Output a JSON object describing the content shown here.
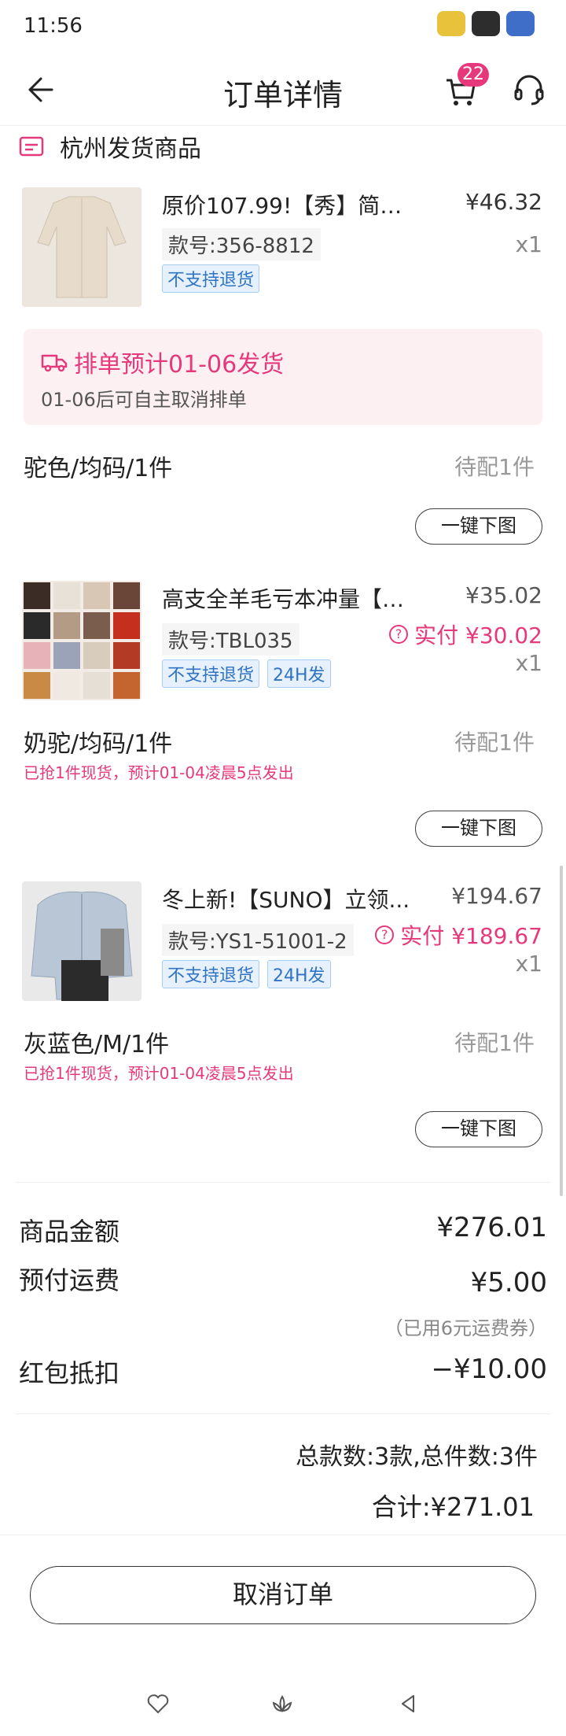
{
  "status_bar": {
    "time": "11:56"
  },
  "nav": {
    "title": "订单详情",
    "cart_badge": "22"
  },
  "section": {
    "title": "杭州发货商品"
  },
  "products": [
    {
      "title": "原价107.99!【秀】简约...",
      "price": "¥46.32",
      "code": "款号:356-8812",
      "qty": "x1",
      "tags": [
        "不支持退货"
      ],
      "notice_title": "排单预计01-06发货",
      "notice_sub": "01-06后可自主取消排单",
      "variant": "驼色/均码/1件",
      "pending": "待配1件",
      "download": "一键下图"
    },
    {
      "title": "高支全羊毛亏本冲量【M...",
      "price": "¥35.02",
      "code": "款号:TBL035",
      "paid_label": "实付 ¥30.02",
      "qty": "x1",
      "tags": [
        "不支持退货",
        "24H发"
      ],
      "variant": "奶驼/均码/1件",
      "pending": "待配1件",
      "stock_note": "已抢1件现货，预计01-04凌晨5点发出",
      "download": "一键下图"
    },
    {
      "title": "冬上新!【SUNO】立领...",
      "price": "¥194.67",
      "code": "款号:YS1-51001-2",
      "paid_label": "实付 ¥189.67",
      "qty": "x1",
      "tags": [
        "不支持退货",
        "24H发"
      ],
      "variant": "灰蓝色/M/1件",
      "pending": "待配1件",
      "stock_note": "已抢1件现货，预计01-04凌晨5点发出",
      "download": "一键下图"
    }
  ],
  "summary": {
    "goods_label": "商品金额",
    "goods_value": "¥276.01",
    "shipping_label": "预付运费",
    "shipping_value": "¥5.00",
    "shipping_coupon": "（已用6元运费券）",
    "redpacket_label": "红包抵扣",
    "redpacket_value": "−¥10.00",
    "count_text": "总款数:3款,总件数:3件",
    "total_text": "合计:¥271.01"
  },
  "actions": {
    "cancel": "取消订单"
  },
  "colors": {
    "accent": "#e6397b",
    "tag_blue": "#2f73c5"
  }
}
